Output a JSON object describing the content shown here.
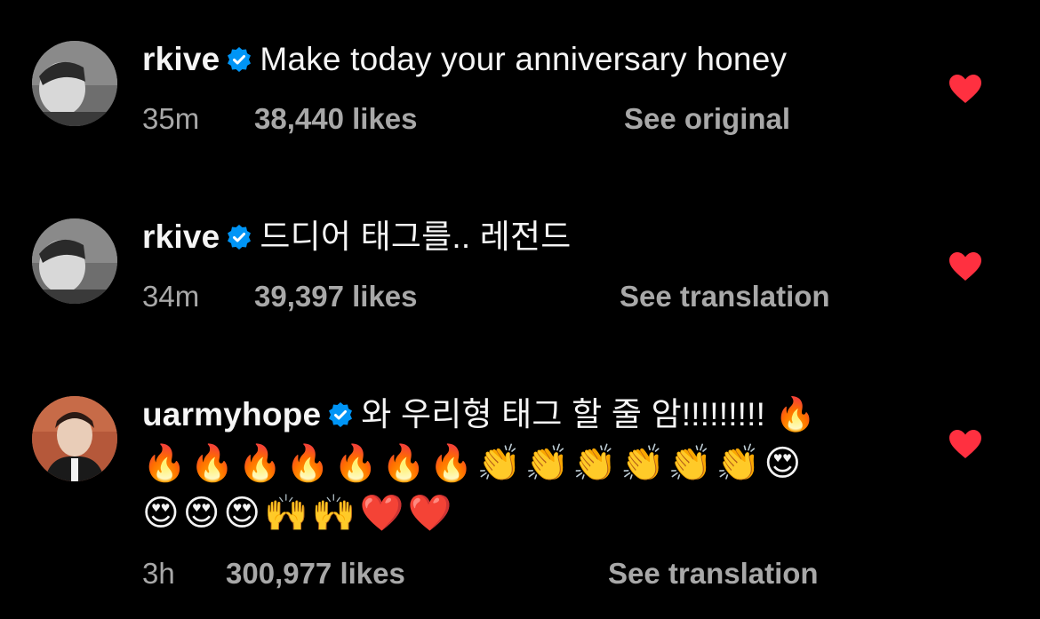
{
  "comments": [
    {
      "username": "rkive",
      "verified": true,
      "text": "Make today your anniversary honey",
      "emoji_lines": [],
      "time": "35m",
      "likes": "38,440 likes",
      "action": "See original",
      "liked": true
    },
    {
      "username": "rkive",
      "verified": true,
      "text": "드디어 태그를.. 레전드",
      "emoji_lines": [],
      "time": "34m",
      "likes": "39,397 likes",
      "action": "See translation",
      "liked": true
    },
    {
      "username": "uarmyhope",
      "verified": true,
      "text": "와 우리형 태그 할 줄 암!!!!!!!!! 🔥",
      "emoji_lines": [
        "🔥🔥🔥🔥🔥🔥🔥👏👏👏👏👏👏😍",
        "😍😍😍🙌🙌❤️❤️"
      ],
      "time": "3h",
      "likes": "300,977 likes",
      "action": "See translation",
      "liked": true
    }
  ],
  "icons": {
    "verified": "verified-badge-icon",
    "like": "heart-icon"
  },
  "colors": {
    "background": "#000000",
    "primary_text": "#f5f5f5",
    "secondary_text": "#a8a8a8",
    "verified_blue": "#0095f6",
    "heart_red": "#ff3040"
  }
}
